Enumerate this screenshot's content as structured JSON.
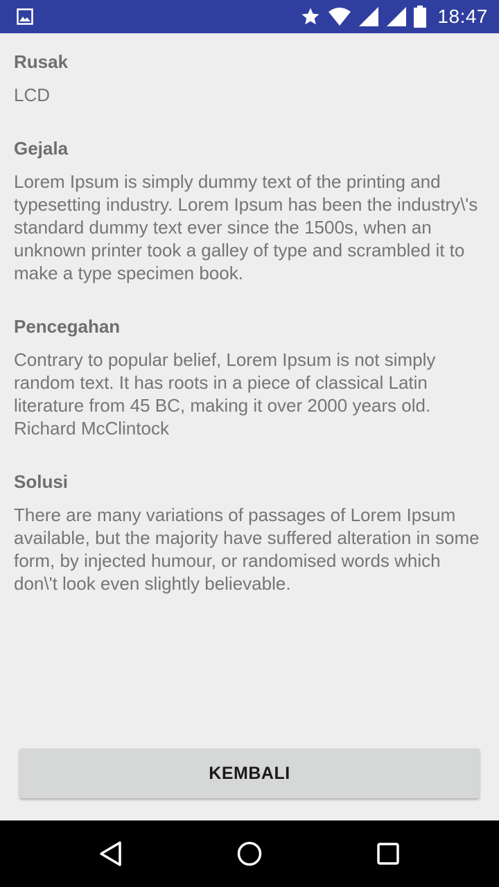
{
  "status_bar": {
    "time": "18:47",
    "background": "#303f9f",
    "icons": [
      "image-notification-icon",
      "star-icon",
      "wifi-icon",
      "signal-icon",
      "signal-icon",
      "battery-icon"
    ]
  },
  "sections": [
    {
      "label": "Rusak",
      "value": "LCD"
    },
    {
      "label": "Gejala",
      "value": "Lorem Ipsum is simply dummy text of the printing and typesetting industry. Lorem Ipsum has been the industry\\'s standard dummy text ever since the 1500s, when an unknown printer took a galley of type and scrambled it to make a type specimen book."
    },
    {
      "label": "Pencegahan",
      "value": "Contrary to popular belief, Lorem Ipsum is not simply random text. It has roots in a piece of classical Latin literature from 45 BC, making it over 2000 years old. Richard McClintock"
    },
    {
      "label": "Solusi",
      "value": "There are many variations of passages of Lorem Ipsum available, but the majority have suffered alteration in some form, by injected humour, or randomised words which don\\'t look even slightly believable."
    }
  ],
  "button": {
    "label": "KEMBALI"
  },
  "nav_bar": {
    "icons": [
      "back-icon",
      "home-icon",
      "recents-icon"
    ]
  }
}
